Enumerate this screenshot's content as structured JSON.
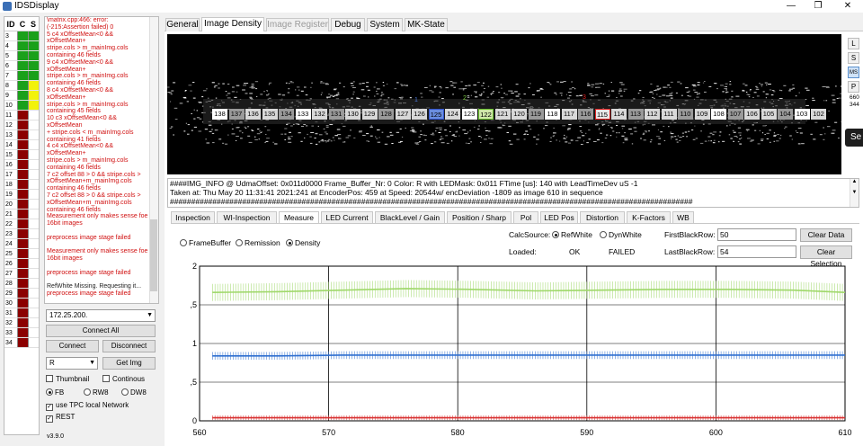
{
  "window": {
    "title": "IDSDisplay",
    "controls": [
      "—",
      "❐",
      "✕"
    ]
  },
  "id_table": {
    "headers": [
      "ID",
      "C",
      "S"
    ],
    "rows": [
      {
        "id": "3",
        "c": "#1aa01a",
        "s": "#1aa01a"
      },
      {
        "id": "4",
        "c": "#1aa01a",
        "s": "#1aa01a"
      },
      {
        "id": "5",
        "c": "#1aa01a",
        "s": "#1aa01a"
      },
      {
        "id": "6",
        "c": "#1aa01a",
        "s": "#1aa01a"
      },
      {
        "id": "7",
        "c": "#1aa01a",
        "s": "#1aa01a"
      },
      {
        "id": "8",
        "c": "#1aa01a",
        "s": "#f2f20a"
      },
      {
        "id": "9",
        "c": "#1aa01a",
        "s": "#f2f20a"
      },
      {
        "id": "10",
        "c": "#1aa01a",
        "s": "#f2f20a"
      },
      {
        "id": "11",
        "c": "#8b0000",
        "s": "#ffffff"
      },
      {
        "id": "12",
        "c": "#8b0000",
        "s": "#ffffff"
      },
      {
        "id": "13",
        "c": "#8b0000",
        "s": "#ffffff"
      },
      {
        "id": "14",
        "c": "#8b0000",
        "s": "#ffffff"
      },
      {
        "id": "15",
        "c": "#8b0000",
        "s": "#ffffff"
      },
      {
        "id": "16",
        "c": "#8b0000",
        "s": "#ffffff"
      },
      {
        "id": "17",
        "c": "#8b0000",
        "s": "#ffffff"
      },
      {
        "id": "18",
        "c": "#8b0000",
        "s": "#ffffff"
      },
      {
        "id": "19",
        "c": "#8b0000",
        "s": "#ffffff"
      },
      {
        "id": "20",
        "c": "#8b0000",
        "s": "#ffffff"
      },
      {
        "id": "21",
        "c": "#8b0000",
        "s": "#ffffff"
      },
      {
        "id": "22",
        "c": "#8b0000",
        "s": "#ffffff"
      },
      {
        "id": "23",
        "c": "#8b0000",
        "s": "#ffffff"
      },
      {
        "id": "24",
        "c": "#8b0000",
        "s": "#ffffff"
      },
      {
        "id": "25",
        "c": "#8b0000",
        "s": "#ffffff"
      },
      {
        "id": "26",
        "c": "#8b0000",
        "s": "#ffffff"
      },
      {
        "id": "27",
        "c": "#8b0000",
        "s": "#ffffff"
      },
      {
        "id": "28",
        "c": "#8b0000",
        "s": "#ffffff"
      },
      {
        "id": "29",
        "c": "#8b0000",
        "s": "#ffffff"
      },
      {
        "id": "30",
        "c": "#8b0000",
        "s": "#ffffff"
      },
      {
        "id": "31",
        "c": "#8b0000",
        "s": "#ffffff"
      },
      {
        "id": "32",
        "c": "#8b0000",
        "s": "#ffffff"
      },
      {
        "id": "33",
        "c": "#8b0000",
        "s": "#ffffff"
      },
      {
        "id": "34",
        "c": "#8b0000",
        "s": "#ffffff"
      }
    ]
  },
  "log": [
    {
      "text": "\\matrix.cpp:466: error:\n(-215:Assertion failed) 0",
      "color": "red"
    },
    {
      "text": "5 c4 xOffsetMean<0 && xOffsetMean+\nstripe.cols > m_mainImg.cols\ncontaining 46 fields",
      "color": "red"
    },
    {
      "text": "9 c4 xOffsetMean<0 && xOffsetMean+\nstripe.cols > m_mainImg.cols\ncontaining 46 fields",
      "color": "red"
    },
    {
      "text": "8 c4 xOffsetMean<0 && xOffsetMean+\nstripe.cols > m_mainImg.cols\ncontaining 45 fields",
      "color": "red"
    },
    {
      "text": "10 c3 xOffsetMean<0 && xOffsetMean\n+ stripe.cols < m_mainImg.cols\ncontaining 41 fields",
      "color": "red"
    },
    {
      "text": "4 c4 xOffsetMean<0 && xOffsetMean+\nstripe.cols > m_mainImg.cols\ncontaining 46 fields",
      "color": "red"
    },
    {
      "text": "7 c2 offset 88 > 0 && stripe.cols >\nxOffsetMean+m_mainImg.cols\ncontaining 46 fields",
      "color": "red"
    },
    {
      "text": "7 c2 offset 88 > 0 && stripe.cols >\nxOffsetMean+m_mainImg.cols\ncontaining 46 fields",
      "color": "red"
    },
    {
      "text": "Measurement only makes sense foe\n16bit images",
      "color": "red"
    },
    {
      "text": " ",
      "color": "red"
    },
    {
      "text": "preprocess image stage failed",
      "color": "red"
    },
    {
      "text": " ",
      "color": "red"
    },
    {
      "text": "Measurement only makes sense foe\n16bit images",
      "color": "red"
    },
    {
      "text": " ",
      "color": "red"
    },
    {
      "text": "preprocess image stage failed",
      "color": "red"
    },
    {
      "text": " ",
      "color": "red"
    },
    {
      "text": "RefWhite Missing. Requesting it...",
      "color": "black"
    },
    {
      "text": "preprocess image stage failed",
      "color": "red"
    },
    {
      "text": " ",
      "color": "red"
    },
    {
      "text": "preprocess image stage failed",
      "color": "red"
    }
  ],
  "left_panel": {
    "ip_value": "172.25.200.",
    "connect_all": "Connect All",
    "connect": "Connect",
    "disconnect": "Disconnect",
    "channel_value": "R",
    "get_img": "Get Img",
    "thumbnail": "Thumbnail",
    "continous": "Continous",
    "fb": "FB",
    "rw8": "RW8",
    "dw8": "DW8",
    "use_tpc": "use TPC local Network",
    "rest": "REST",
    "version": "v3.9.0"
  },
  "main_tabs": [
    {
      "label": "General",
      "state": "normal"
    },
    {
      "label": "Image Density",
      "state": "active"
    },
    {
      "label": "Image Register",
      "state": "disabled"
    },
    {
      "label": "Debug",
      "state": "normal"
    },
    {
      "label": "System",
      "state": "normal"
    },
    {
      "label": "MK-State",
      "state": "normal"
    }
  ],
  "side_buttons": [
    "L",
    "S",
    "MS",
    "P"
  ],
  "side_values": [
    "660",
    "344"
  ],
  "se_label": "Se",
  "image_view": {
    "pixel_labels": [
      "138",
      "137",
      "136",
      "135",
      "134",
      "133",
      "132",
      "131",
      "130",
      "129",
      "128",
      "127",
      "126",
      "125",
      "124",
      "123",
      "122",
      "121",
      "120",
      "119",
      "118",
      "117",
      "116",
      "115",
      "114",
      "113",
      "112",
      "111",
      "110",
      "109",
      "108",
      "107",
      "106",
      "105",
      "104",
      "103",
      "102"
    ],
    "marker_1": "1",
    "marker_2": "2",
    "marker_3": "3"
  },
  "info": {
    "line1": "####IMG_INFO @ UdmaOffset: 0x011d0000 Frame_Buffer_Nr: 0 Color: R with LEDMask: 0x011 FTime [us]: 140 with LeadTimeDev uS -1",
    "line2": "Taken at: Thu May 20 11:31:41 2021:241 at EncoderPos: 459 at Speed: 20544w/ encDeviation -1809 as image 610 in sequence",
    "line3": "###########################################################################################################################"
  },
  "sub_tabs": [
    "Inspection",
    "WI-Inspection",
    "Measure",
    "LED Current",
    "BlackLevel / Gain",
    "Position / Sharp",
    "Pol",
    "LED Pos",
    "Distortion",
    "K-Factors",
    "WB"
  ],
  "measure": {
    "framebuffer": "FrameBuffer",
    "remission": "Remission",
    "density": "Density",
    "calc_source": "CalcSource:",
    "refwhite": "RefWhite",
    "dynwhite": "DynWhite",
    "loaded": "Loaded:",
    "ok": "OK",
    "failed": "FAILED",
    "first_black_row_label": "FirstBlackRow:",
    "first_black_row": "50",
    "last_black_row_label": "LastBlackRow:",
    "last_black_row": "54",
    "clear_data": "Clear Data",
    "clear_selection": "Clear Selection"
  },
  "chart_data": {
    "type": "line",
    "x_range": [
      560,
      610
    ],
    "ylim": [
      0,
      2
    ],
    "x_ticks": [
      "560",
      "570",
      "580",
      "590",
      "600",
      "610"
    ],
    "y_ticks": [
      "0",
      "0,5",
      "1",
      "1,5",
      "2"
    ],
    "series": [
      {
        "color": "#9fd86a",
        "x": [
          561,
          566,
          571,
          576,
          581,
          586,
          591,
          596,
          601,
          606,
          610
        ],
        "y": [
          1.66,
          1.67,
          1.69,
          1.71,
          1.7,
          1.68,
          1.69,
          1.7,
          1.7,
          1.69,
          1.66
        ],
        "spread": 0.11
      },
      {
        "color": "#2f6fd0",
        "x": [
          561,
          566,
          571,
          576,
          581,
          586,
          591,
          596,
          601,
          606,
          610
        ],
        "y": [
          0.84,
          0.84,
          0.85,
          0.85,
          0.85,
          0.85,
          0.85,
          0.85,
          0.85,
          0.85,
          0.85
        ],
        "spread": 0.05
      },
      {
        "color": "#d83030",
        "x": [
          561,
          566,
          571,
          576,
          581,
          586,
          591,
          596,
          601,
          606,
          610
        ],
        "y": [
          0.04,
          0.04,
          0.04,
          0.04,
          0.04,
          0.04,
          0.04,
          0.04,
          0.04,
          0.04,
          0.04
        ],
        "spread": 0.03
      }
    ],
    "grid": true
  }
}
